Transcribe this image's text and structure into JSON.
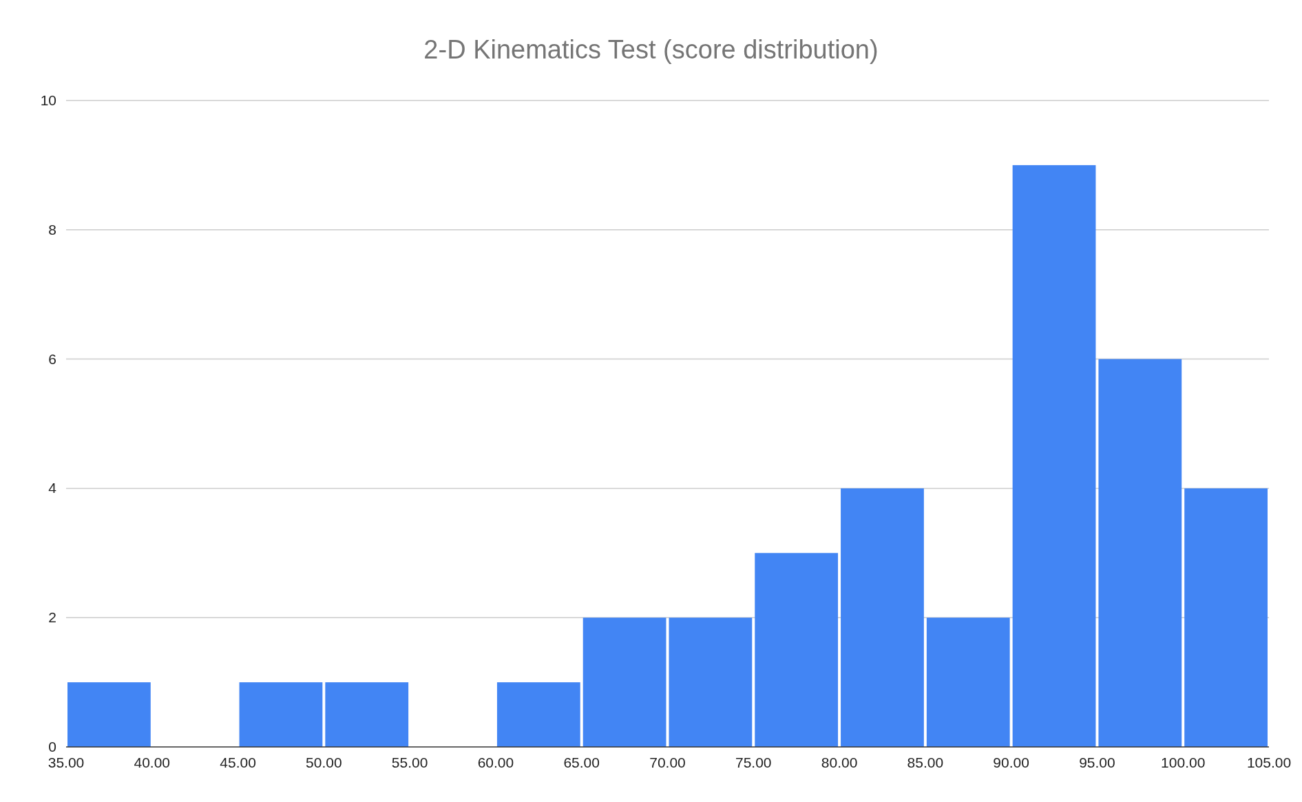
{
  "chart": {
    "chart_data": {
      "type": "bar",
      "title": "2-D Kinematics Test (score distribution)",
      "grid": true,
      "x": [
        37.5,
        47.5,
        52.5,
        62.5,
        67.5,
        72.5,
        77.5,
        82.5,
        87.5,
        92.5,
        97.5,
        102.5
      ],
      "values": [
        1,
        1,
        1,
        1,
        2,
        2,
        3,
        4,
        2,
        9,
        6,
        4
      ],
      "xlim": [
        35,
        105
      ],
      "ylim": [
        0,
        10
      ],
      "xticks": [
        {
          "value": 35,
          "label": "35.00"
        },
        {
          "value": 40,
          "label": "40.00"
        },
        {
          "value": 45,
          "label": "45.00"
        },
        {
          "value": 50,
          "label": "50.00"
        },
        {
          "value": 55,
          "label": "55.00"
        },
        {
          "value": 60,
          "label": "60.00"
        },
        {
          "value": 65,
          "label": "65.00"
        },
        {
          "value": 70,
          "label": "70.00"
        },
        {
          "value": 75,
          "label": "75.00"
        },
        {
          "value": 80,
          "label": "80.00"
        },
        {
          "value": 85,
          "label": "85.00"
        },
        {
          "value": 90,
          "label": "90.00"
        },
        {
          "value": 95,
          "label": "95.00"
        },
        {
          "value": 100,
          "label": "100.00"
        },
        {
          "value": 105,
          "label": "105.00"
        }
      ],
      "yticks": [
        0,
        2,
        4,
        6,
        8,
        10
      ]
    }
  }
}
